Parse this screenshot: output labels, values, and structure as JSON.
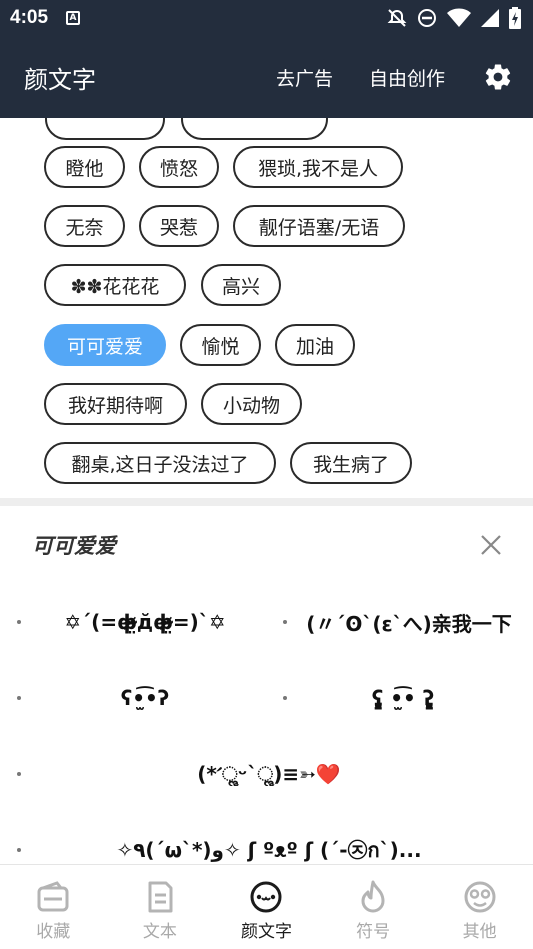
{
  "status_bar": {
    "time": "4:05",
    "notif_icon": "A"
  },
  "app_bar": {
    "title": "颜文字",
    "remove_ads": "去广告",
    "free_create": "自由创作"
  },
  "tags": {
    "partial_top": [
      "",
      ""
    ],
    "rows": [
      [
        "瞪他",
        "愤怒",
        "猥琐,我不是人"
      ],
      [
        "无奈",
        "哭惹",
        "靓仔语塞/无语"
      ],
      [
        "✽✽花花花",
        "高兴"
      ],
      [
        "可可爱爱",
        "愉悦",
        "加油"
      ],
      [
        "我好期待啊",
        "小动物"
      ],
      [
        "翻桌,这日子没法过了",
        "我生病了"
      ]
    ],
    "selected": "可可爱爱"
  },
  "panel": {
    "title": "可可爱爱",
    "items": [
      "✡ˊ(=ф̴̶̷̤д̆ф̴̶̷̤=)ˋ✡",
      "(〃´ʘ`(ε`へ)亲我一下",
      "ʕ•̫͡•ʔ",
      "ʕ̡̢̡̧ •̫͡• ʔ̢̡̢̣̣̣̣",
      "(*ˊૢᵕˋૢ)≡➳",
      "✧٩(ˊωˋ*)و✧ ʃ ºᴥº ʃ (´-㉨ก`)..."
    ],
    "heart": "❤️"
  },
  "bottom_nav": {
    "items": [
      "收藏",
      "文本",
      "颜文字",
      "符号",
      "其他"
    ],
    "active": "颜文字"
  },
  "colors": {
    "bar_bg": "#232d3d",
    "accent": "#54a7f6",
    "nav_inactive": "#a9a9a9"
  }
}
